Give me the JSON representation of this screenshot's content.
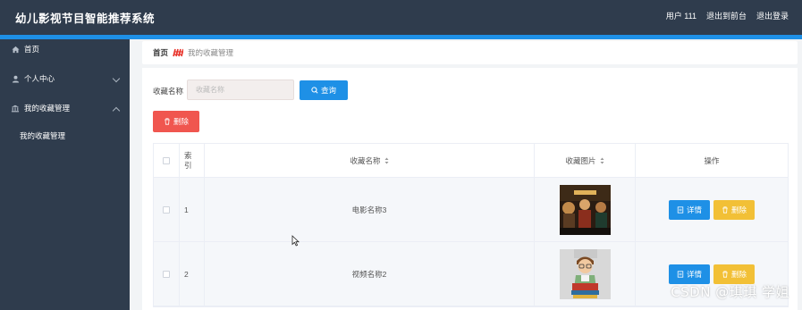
{
  "app": {
    "title": "幼儿影视节目智能推荐系统"
  },
  "topbar": {
    "user": "用户 111",
    "to_front": "退出到前台",
    "logout": "退出登录"
  },
  "sidebar": {
    "items": [
      {
        "label": "首页",
        "icon": "home-icon"
      },
      {
        "label": "个人中心",
        "icon": "user-icon"
      },
      {
        "label": "我的收藏管理",
        "icon": "bank-icon"
      }
    ],
    "sub_items": [
      {
        "label": "我的收藏管理"
      }
    ]
  },
  "breadcrumb": {
    "home": "首页",
    "current": "我的收藏管理"
  },
  "search": {
    "label": "收藏名称",
    "placeholder": "收藏名称",
    "value": "",
    "button": "查询"
  },
  "actions": {
    "delete": "删除"
  },
  "table": {
    "headers": {
      "index": "索引",
      "name": "收藏名称",
      "picture": "收藏图片",
      "ops": "操作"
    },
    "rows": [
      {
        "index": "1",
        "name": "电影名称3",
        "picture": "movie-poster",
        "detail": "详情",
        "delete": "删除"
      },
      {
        "index": "2",
        "name": "视频名称2",
        "picture": "cartoon-reader",
        "detail": "详情",
        "delete": "删除"
      }
    ]
  },
  "watermark": "CSDN @琪琪 学姐",
  "colors": {
    "header_bg": "#2f3c4d",
    "accent": "#1e90e6",
    "danger": "#f0564f",
    "warning": "#f2c036"
  }
}
